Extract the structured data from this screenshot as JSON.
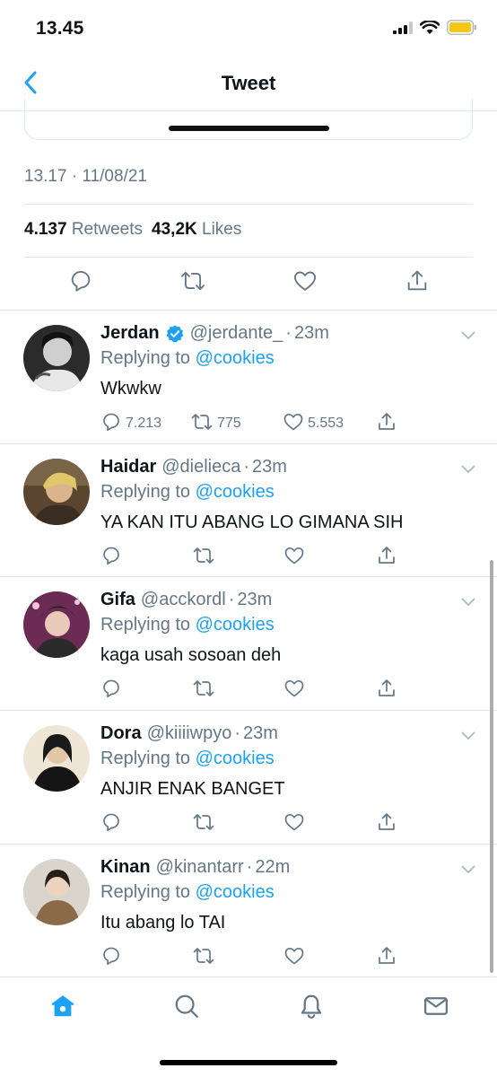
{
  "status_bar": {
    "time": "13.45"
  },
  "nav": {
    "title": "Tweet"
  },
  "tweet": {
    "timestamp": "13.17 · 11/08/21",
    "retweets_count": "4.137",
    "retweets_label": "Retweets",
    "likes_count": "43,2K",
    "likes_label": "Likes"
  },
  "replies": [
    {
      "name": "Jerdan",
      "handle": "@jerdante_",
      "time": "23m",
      "verified": true,
      "replying_label": "Replying to",
      "replying_to": "@cookies",
      "text": "Wkwkw",
      "reply_count": "7.213",
      "retweet_count": "775",
      "like_count": "5.553"
    },
    {
      "name": "Haidar",
      "handle": "@dielieca",
      "time": "23m",
      "verified": false,
      "replying_label": "Replying to",
      "replying_to": "@cookies",
      "text": "YA KAN ITU ABANG LO GIMANA SIH"
    },
    {
      "name": "Gifa",
      "handle": "@acckordl",
      "time": "23m",
      "verified": false,
      "replying_label": "Replying to",
      "replying_to": "@cookies",
      "text": "kaga usah sosoan deh"
    },
    {
      "name": "Dora",
      "handle": "@kiiiiwpyo",
      "time": "23m",
      "verified": false,
      "replying_label": "Replying to",
      "replying_to": "@cookies",
      "text": "ANJIR ENAK BANGET"
    },
    {
      "name": "Kinan",
      "handle": "@kinantarr",
      "time": "22m",
      "verified": false,
      "replying_label": "Replying to",
      "replying_to": "@cookies",
      "text": "Itu abang lo TAI"
    }
  ],
  "colors": {
    "accent": "#1da1f2",
    "secondary_text": "#657786",
    "divider": "#e1e8ed",
    "battery": "#f5c518"
  },
  "icons": {
    "back": "chevron-left-icon",
    "reply": "reply-icon",
    "retweet": "retweet-icon",
    "like": "heart-icon",
    "share": "share-icon",
    "home": "home-icon",
    "search": "search-icon",
    "notifications": "bell-icon",
    "messages": "mail-icon"
  }
}
